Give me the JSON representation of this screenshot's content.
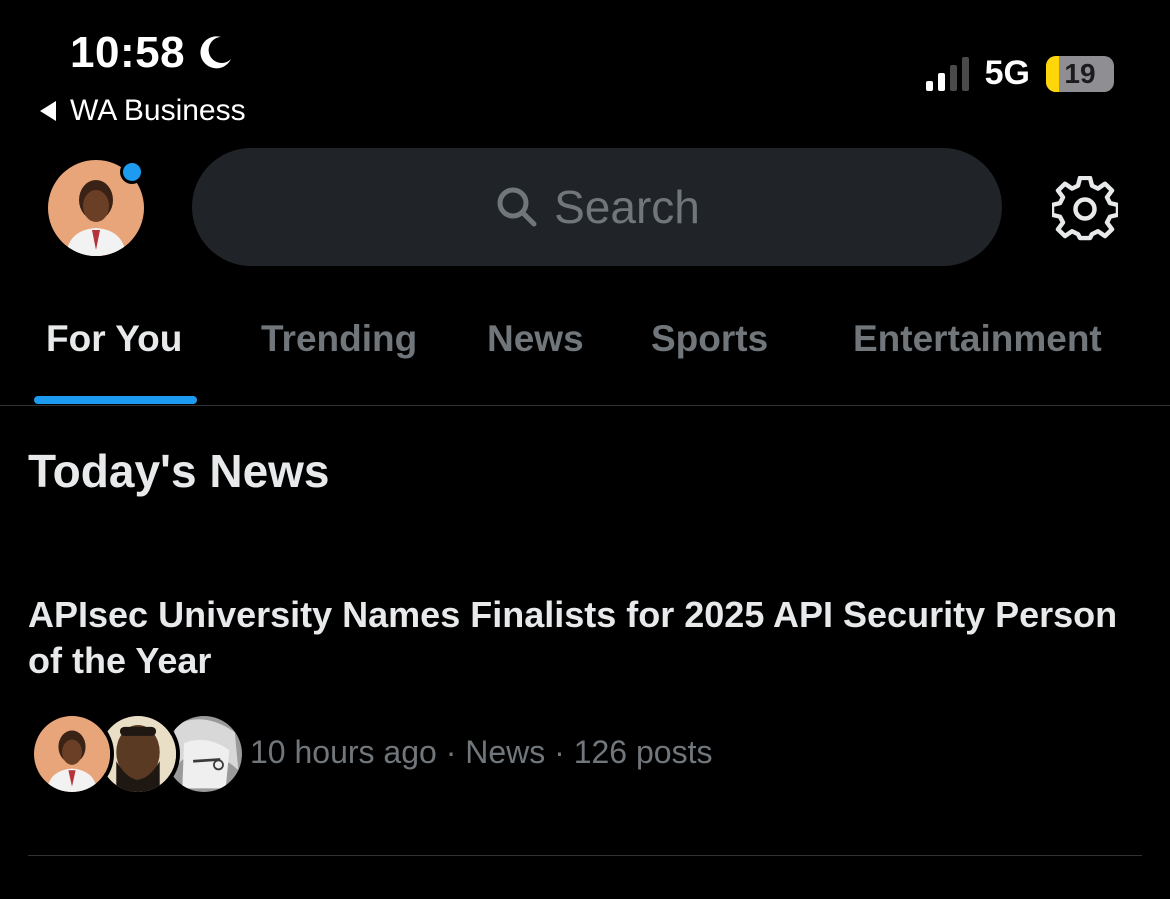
{
  "status_bar": {
    "time": "10:58",
    "back_app": "WA Business",
    "network": "5G",
    "battery_level": "19",
    "battery_fraction": 0.19,
    "signal_bars_active": 2,
    "signal_bars_total": 4,
    "icons": [
      "moon-icon",
      "signal-icon",
      "battery-icon"
    ]
  },
  "header": {
    "search_placeholder": "Search",
    "icons": [
      "avatar",
      "search-icon",
      "gear-icon"
    ],
    "notification_color": "#1d9bf0"
  },
  "tabs": [
    {
      "label": "For You",
      "active": true
    },
    {
      "label": "Trending",
      "active": false
    },
    {
      "label": "News",
      "active": false
    },
    {
      "label": "Sports",
      "active": false
    },
    {
      "label": "Entertainment",
      "active": false
    }
  ],
  "section": {
    "title": "Today's News"
  },
  "story": {
    "headline": "APIsec University Names Finalists for 2025 API Security Person of the Year",
    "meta": "10 hours ago · News · 126 posts"
  },
  "colors": {
    "accent": "#1d9bf0",
    "background": "#000000",
    "muted_text": "#71767b",
    "primary_text": "#e7e9ea",
    "battery_low": "#ffd60a"
  }
}
